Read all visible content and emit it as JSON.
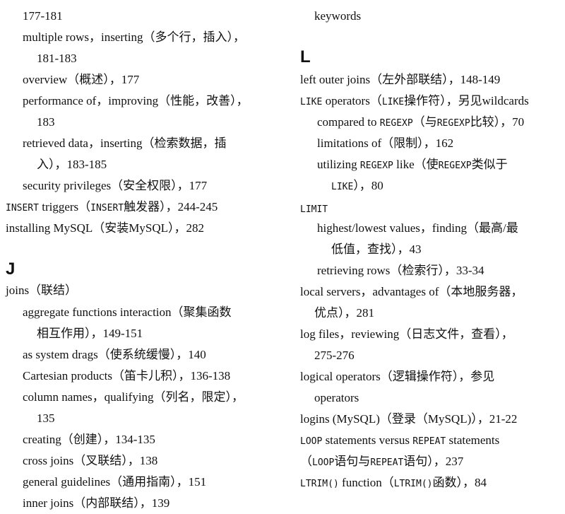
{
  "left": {
    "l01": "177-181",
    "l02": "multiple rows，inserting（多个行，插入），",
    "l03": "181-183",
    "l04": "overview（概述），177",
    "l05": "performance of，improving（性能，改善），",
    "l06": "183",
    "l07": "retrieved data，inserting（检索数据，插",
    "l08": "入），183-185",
    "l09": "security privileges（安全权限），177",
    "l10_mono": "INSERT",
    "l10a": " triggers（",
    "l10_mono2": "INSERT",
    "l10b": "触发器），244-245",
    "l11": "installing MySQL（安装MySQL），282",
    "heading_j": "J",
    "l12": "joins（联结）",
    "l13": "aggregate functions interaction（聚集函数",
    "l14": "相互作用），149-151",
    "l15": "as system drags（使系统缓慢），140",
    "l16": "Cartesian products（笛卡儿积），136-138",
    "l17": "column names，qualifying（列名，限定），",
    "l18": "135",
    "l19": "creating（创建），134-135",
    "l20": "cross joins（叉联结），138",
    "l21": "general guidelines（通用指南），151",
    "l22": "inner joins（内部联结），139"
  },
  "right": {
    "r01": "keywords",
    "heading_l": "L",
    "r02": "left outer joins（左外部联结），148-149",
    "r03_mono": "LIKE",
    "r03a": " operators（",
    "r03_mono2": "LIKE",
    "r03b": "操作符），另见wildcards",
    "r04a": "compared to ",
    "r04_mono": "REGEXP",
    "r04b": "（与",
    "r04_mono2": "REGEXP",
    "r04c": "比较），70",
    "r05": "limitations of（限制），162",
    "r06a": "utilizing ",
    "r06_mono": "REGEXP",
    "r06b": " like（使",
    "r06_mono2": "REGEXP",
    "r06c": "类似于",
    "r07_mono": "LIKE",
    "r07b": "），80",
    "r08_mono": "LIMIT",
    "r09": "highest/lowest values，finding（最高/最",
    "r10": "低值，查找），43",
    "r11": "retrieving rows（检索行），33-34",
    "r12": "local servers，advantages of（本地服务器，",
    "r13": "优点），281",
    "r14": "log files，reviewing（日志文件，查看），",
    "r15": "275-276",
    "r16": "logical operators（逻辑操作符），参见",
    "r17": "operators",
    "r18": "logins (MySQL)（登录（MySQL)），21-22",
    "r19_mono": "LOOP",
    "r19a": " statements versus ",
    "r19_mono2": "REPEAT",
    "r19b": " statements",
    "r20a": "（",
    "r20_mono": "LOOP",
    "r20b": "语句与",
    "r20_mono2": "REPEAT",
    "r20c": "语句），237",
    "r21_mono": "LTRIM()",
    "r21a": " function（",
    "r21_mono2": "LTRIM()",
    "r21b": "函数），84"
  }
}
